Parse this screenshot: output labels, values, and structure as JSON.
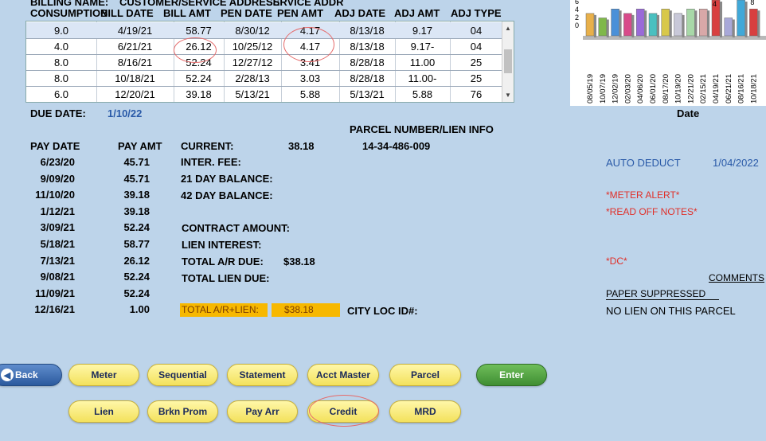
{
  "topcut": {
    "a": "BILLING NAME:",
    "b": "CUSTOMER/SERVICE ADDRESS",
    "c": "SERVICE ADDR"
  },
  "columns": [
    "CONSUMPTION",
    "BILL DATE",
    "BILL AMT",
    "PEN DATE",
    "PEN AMT",
    "ADJ DATE",
    "ADJ AMT",
    "ADJ TYPE"
  ],
  "rows": [
    [
      "9.0",
      "4/19/21",
      "58.77",
      "8/30/12",
      "4.17",
      "8/13/18",
      "9.17",
      "04"
    ],
    [
      "4.0",
      "6/21/21",
      "26.12",
      "10/25/12",
      "4.17",
      "8/13/18",
      "9.17-",
      "04"
    ],
    [
      "8.0",
      "8/16/21",
      "52.24",
      "12/27/12",
      "3.41",
      "8/28/18",
      "11.00",
      "25"
    ],
    [
      "8.0",
      "10/18/21",
      "52.24",
      "2/28/13",
      "3.03",
      "8/28/18",
      "11.00-",
      "25"
    ],
    [
      "6.0",
      "12/20/21",
      "39.18",
      "5/13/21",
      "5.88",
      "5/13/21",
      "5.88",
      "76"
    ]
  ],
  "chart_data": {
    "type": "bar",
    "y_ticks": [
      "6",
      "4",
      "2",
      "0"
    ],
    "x": [
      "08/05/19",
      "10/07/19",
      "12/02/19",
      "02/03/20",
      "04/06/20",
      "06/01/20",
      "08/17/20",
      "10/19/20",
      "12/21/20",
      "02/15/21",
      "04/19/21",
      "06/21/21",
      "08/16/21",
      "10/18/21"
    ],
    "values": [
      5,
      4,
      6,
      5,
      6,
      5,
      6,
      5,
      6,
      6,
      8,
      4,
      8,
      6
    ],
    "colors": [
      "#e8b04a",
      "#7fb84a",
      "#4a90d8",
      "#d84a8a",
      "#9a6ad8",
      "#4ac0c0",
      "#d8c84a",
      "#c8c8d8",
      "#a8d8a8",
      "#d8a8a8",
      "#d84040",
      "#a8a8d8",
      "#40a8d8",
      "#d84040"
    ],
    "bar_labels": [
      "4",
      "8"
    ],
    "xlabel": "Date"
  },
  "due": {
    "label": "DUE DATE:",
    "value": "1/10/22"
  },
  "parcel_header": "PARCEL NUMBER/LIEN INFO",
  "pay_headers": {
    "date": "PAY DATE",
    "amt": "PAY AMT"
  },
  "payments": [
    [
      "6/23/20",
      "45.71"
    ],
    [
      "9/09/20",
      "45.71"
    ],
    [
      "11/10/20",
      "39.18"
    ],
    [
      "1/12/21",
      "39.18"
    ],
    [
      "3/09/21",
      "52.24"
    ],
    [
      "5/18/21",
      "58.77"
    ],
    [
      "7/13/21",
      "26.12"
    ],
    [
      "9/08/21",
      "52.24"
    ],
    [
      "11/09/21",
      "52.24"
    ],
    [
      "12/16/21",
      "1.00"
    ]
  ],
  "summary": {
    "current_label": "CURRENT:",
    "current_value": "38.18",
    "parcel": "14-34-486-009",
    "inter_fee": "INTER. FEE:",
    "day21": "21 DAY BALANCE:",
    "day42": "42 DAY BALANCE:",
    "contract": "CONTRACT AMOUNT:",
    "lien_interest": "LIEN INTEREST:",
    "total_ar_label": "TOTAL A/R DUE:",
    "total_ar_value": "$38.18",
    "total_lien": "TOTAL LIEN DUE:",
    "total_arlien_label": "TOTAL A/R+LIEN:",
    "total_arlien_value": "$38.18",
    "city_loc": "CITY LOC ID#:"
  },
  "right": {
    "auto_deduct": "AUTO DEDUCT",
    "auto_date": "1/04/2022",
    "meter_alert": "*METER ALERT*",
    "read_off": "*READ OFF NOTES*",
    "dc": "*DC*",
    "comments": "COMMENTS",
    "paper": "PAPER SUPPRESSED",
    "no_lien": "NO LIEN ON THIS PARCEL"
  },
  "buttons": {
    "back": "Back",
    "meter": "Meter",
    "sequential": "Sequential",
    "statement": "Statement",
    "acct_master": "Acct Master",
    "parcel": "Parcel",
    "enter": "Enter",
    "lien": "Lien",
    "brkn_prom": "Brkn Prom",
    "pay_arr": "Pay Arr",
    "credit": "Credit",
    "mrd": "MRD"
  }
}
